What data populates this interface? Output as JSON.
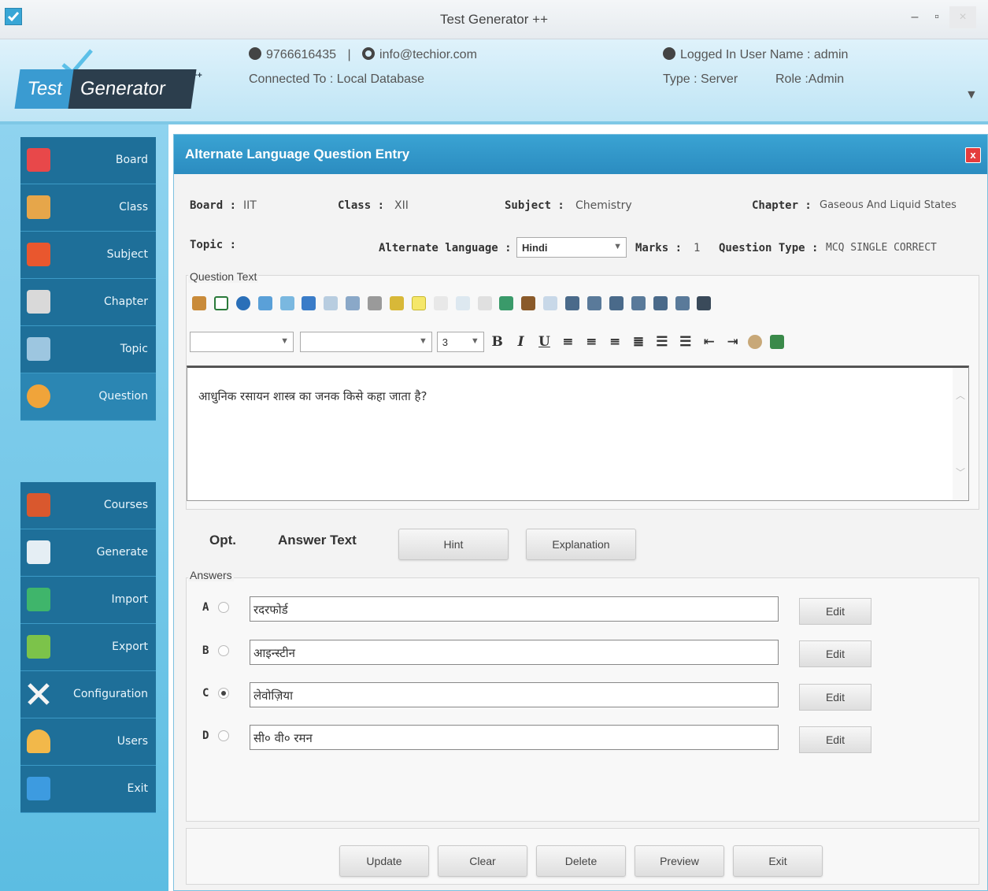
{
  "window": {
    "title": "Test Generator ++"
  },
  "header": {
    "logo_test": "Test",
    "logo_generator": "Generator",
    "logo_plus": "++",
    "phone": "9766616435",
    "separator": "|",
    "email": "info@techior.com",
    "connected_to": "Connected To :  Local Database",
    "logged_in": "Logged In User Name : admin",
    "type": "Type : Server",
    "role": "Role :Admin"
  },
  "sidebar": {
    "items": [
      {
        "label": "Board",
        "color": "#e8484a"
      },
      {
        "label": "Class",
        "color": "#e6a64a"
      },
      {
        "label": "Subject",
        "color": "#e9572e"
      },
      {
        "label": "Chapter",
        "color": "#d9d9d9"
      },
      {
        "label": "Topic",
        "color": "#9dc6e0"
      },
      {
        "label": "Question",
        "color": "#f0a43a"
      }
    ],
    "items2": [
      {
        "label": "Courses",
        "color": "#d9582e"
      },
      {
        "label": "Generate",
        "color": "#e5eef4"
      },
      {
        "label": "Import",
        "color": "#3fb56b"
      },
      {
        "label": "Export",
        "color": "#7cc34a"
      },
      {
        "label": "Configuration",
        "color": "#f4f4f4"
      },
      {
        "label": "Users",
        "color": "#f2b84a"
      },
      {
        "label": "Exit",
        "color": "#3d9be0"
      }
    ]
  },
  "panel": {
    "title": "Alternate Language Question Entry",
    "close": "x",
    "board_label": "Board :",
    "board_value": "IIT",
    "class_label": "Class :",
    "class_value": "XII",
    "subject_label": "Subject :",
    "subject_value": "Chemistry",
    "chapter_label": "Chapter :",
    "chapter_value": "Gaseous And Liquid States",
    "topic_label": "Topic :",
    "alt_lang_label": "Alternate language :",
    "alt_lang_value": "Hindi",
    "marks_label": "Marks :",
    "marks_value": "1",
    "qtype_label": "Question Type :",
    "qtype_value": "MCQ SINGLE CORRECT",
    "question_legend": "Question Text",
    "font_size_value": "3",
    "question_text": "आधुनिक रसायन शास्त्र का जनक किसे कहा जाता है?",
    "opt_header": "Opt.",
    "answer_header": "Answer Text",
    "hint_button": "Hint",
    "explanation_button": "Explanation",
    "answers_legend": "Answers",
    "options": [
      {
        "letter": "A",
        "text": "रदरफोर्ड",
        "selected": false,
        "edit": "Edit"
      },
      {
        "letter": "B",
        "text": "आइन्स्टीन",
        "selected": false,
        "edit": "Edit"
      },
      {
        "letter": "C",
        "text": "लेवोज़िया",
        "selected": true,
        "edit": "Edit"
      },
      {
        "letter": "D",
        "text": "सी० वी० रमन",
        "selected": false,
        "edit": "Edit"
      }
    ],
    "footer_buttons": {
      "update": "Update",
      "clear": "Clear",
      "delete": "Delete",
      "preview": "Preview",
      "exit": "Exit"
    }
  }
}
